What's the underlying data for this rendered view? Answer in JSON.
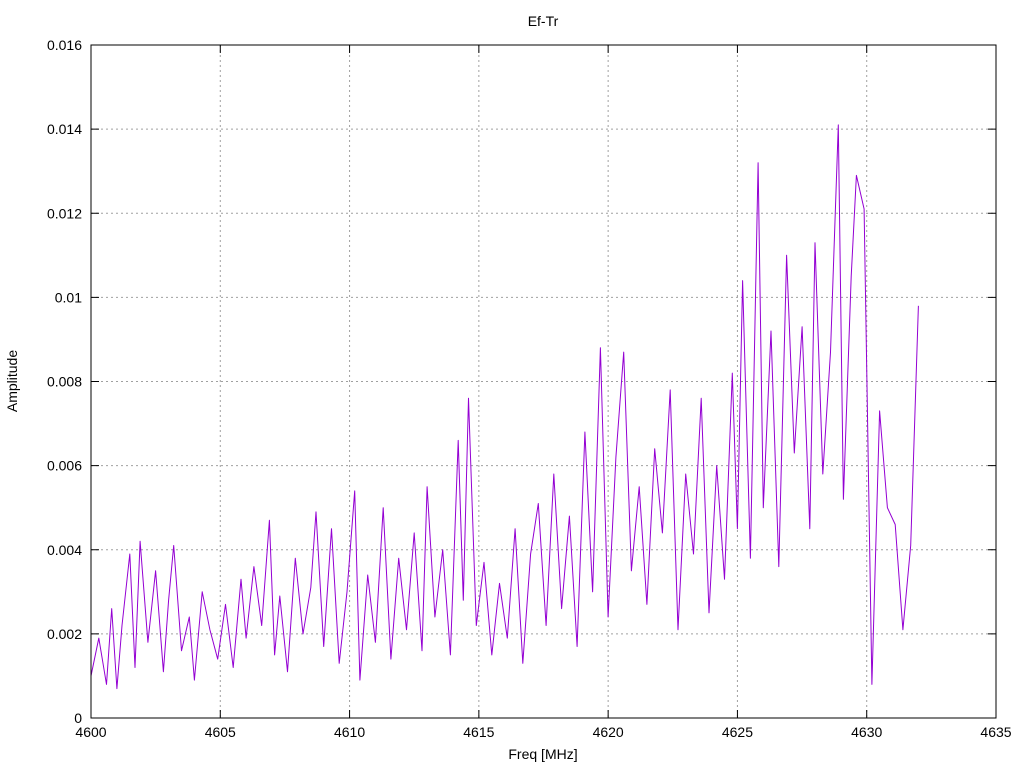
{
  "chart_data": {
    "type": "line",
    "title": "Ef-Tr",
    "xlabel": "Freq [MHz]",
    "ylabel": "Amplitude",
    "xlim": [
      4600,
      4635
    ],
    "ylim": [
      0,
      0.016
    ],
    "x_ticks": [
      "4600",
      "4605",
      "4610",
      "4615",
      "4620",
      "4625",
      "4630",
      "4635"
    ],
    "y_ticks": [
      "0",
      "0.002",
      "0.004",
      "0.006",
      "0.008",
      "0.01",
      "0.012",
      "0.014",
      "0.016"
    ],
    "grid": true,
    "series_color": "#9400d3",
    "series": [
      {
        "points": [
          [
            4600.0,
            0.001
          ],
          [
            4600.3,
            0.0019
          ],
          [
            4600.6,
            0.0008
          ],
          [
            4600.8,
            0.0026
          ],
          [
            4601.0,
            0.0007
          ],
          [
            4601.2,
            0.0022
          ],
          [
            4601.5,
            0.0039
          ],
          [
            4601.7,
            0.0012
          ],
          [
            4601.9,
            0.0042
          ],
          [
            4602.2,
            0.0018
          ],
          [
            4602.5,
            0.0035
          ],
          [
            4602.8,
            0.0011
          ],
          [
            4603.0,
            0.0028
          ],
          [
            4603.2,
            0.0041
          ],
          [
            4603.5,
            0.0016
          ],
          [
            4603.8,
            0.0024
          ],
          [
            4604.0,
            0.0009
          ],
          [
            4604.3,
            0.003
          ],
          [
            4604.6,
            0.0021
          ],
          [
            4604.9,
            0.0014
          ],
          [
            4605.2,
            0.0027
          ],
          [
            4605.5,
            0.0012
          ],
          [
            4605.8,
            0.0033
          ],
          [
            4606.0,
            0.0019
          ],
          [
            4606.3,
            0.0036
          ],
          [
            4606.6,
            0.0022
          ],
          [
            4606.9,
            0.0047
          ],
          [
            4607.1,
            0.0015
          ],
          [
            4607.3,
            0.0029
          ],
          [
            4607.6,
            0.0011
          ],
          [
            4607.9,
            0.0038
          ],
          [
            4608.2,
            0.002
          ],
          [
            4608.5,
            0.0031
          ],
          [
            4608.7,
            0.0049
          ],
          [
            4609.0,
            0.0017
          ],
          [
            4609.3,
            0.0045
          ],
          [
            4609.6,
            0.0013
          ],
          [
            4609.9,
            0.003
          ],
          [
            4610.2,
            0.0054
          ],
          [
            4610.4,
            0.0009
          ],
          [
            4610.7,
            0.0034
          ],
          [
            4611.0,
            0.0018
          ],
          [
            4611.3,
            0.005
          ],
          [
            4611.6,
            0.0014
          ],
          [
            4611.9,
            0.0038
          ],
          [
            4612.2,
            0.0021
          ],
          [
            4612.5,
            0.0044
          ],
          [
            4612.8,
            0.0016
          ],
          [
            4613.0,
            0.0055
          ],
          [
            4613.3,
            0.0024
          ],
          [
            4613.6,
            0.004
          ],
          [
            4613.9,
            0.0015
          ],
          [
            4614.2,
            0.0066
          ],
          [
            4614.4,
            0.0028
          ],
          [
            4614.6,
            0.0076
          ],
          [
            4614.9,
            0.0022
          ],
          [
            4615.2,
            0.0037
          ],
          [
            4615.5,
            0.0015
          ],
          [
            4615.8,
            0.0032
          ],
          [
            4616.1,
            0.0019
          ],
          [
            4616.4,
            0.0045
          ],
          [
            4616.7,
            0.0013
          ],
          [
            4617.0,
            0.0039
          ],
          [
            4617.3,
            0.0051
          ],
          [
            4617.6,
            0.0022
          ],
          [
            4617.9,
            0.0058
          ],
          [
            4618.2,
            0.0026
          ],
          [
            4618.5,
            0.0048
          ],
          [
            4618.8,
            0.0017
          ],
          [
            4619.1,
            0.0068
          ],
          [
            4619.4,
            0.003
          ],
          [
            4619.7,
            0.0088
          ],
          [
            4620.0,
            0.0024
          ],
          [
            4620.3,
            0.0062
          ],
          [
            4620.6,
            0.0087
          ],
          [
            4620.9,
            0.0035
          ],
          [
            4621.2,
            0.0055
          ],
          [
            4621.5,
            0.0027
          ],
          [
            4621.8,
            0.0064
          ],
          [
            4622.1,
            0.0044
          ],
          [
            4622.4,
            0.0078
          ],
          [
            4622.7,
            0.0021
          ],
          [
            4623.0,
            0.0058
          ],
          [
            4623.3,
            0.0039
          ],
          [
            4623.6,
            0.0076
          ],
          [
            4623.9,
            0.0025
          ],
          [
            4624.2,
            0.006
          ],
          [
            4624.5,
            0.0033
          ],
          [
            4624.8,
            0.0082
          ],
          [
            4625.0,
            0.0045
          ],
          [
            4625.2,
            0.0104
          ],
          [
            4625.5,
            0.0038
          ],
          [
            4625.8,
            0.0132
          ],
          [
            4626.0,
            0.005
          ],
          [
            4626.3,
            0.0092
          ],
          [
            4626.6,
            0.0036
          ],
          [
            4626.9,
            0.011
          ],
          [
            4627.2,
            0.0063
          ],
          [
            4627.5,
            0.0093
          ],
          [
            4627.8,
            0.0045
          ],
          [
            4628.0,
            0.0113
          ],
          [
            4628.3,
            0.0058
          ],
          [
            4628.6,
            0.0087
          ],
          [
            4628.9,
            0.0141
          ],
          [
            4629.1,
            0.0052
          ],
          [
            4629.4,
            0.0105
          ],
          [
            4629.6,
            0.0129
          ],
          [
            4629.9,
            0.0121
          ],
          [
            4630.2,
            0.0008
          ],
          [
            4630.5,
            0.0073
          ],
          [
            4630.8,
            0.005
          ],
          [
            4631.1,
            0.0046
          ],
          [
            4631.4,
            0.0021
          ],
          [
            4631.7,
            0.0041
          ],
          [
            4632.0,
            0.0098
          ]
        ]
      }
    ]
  }
}
